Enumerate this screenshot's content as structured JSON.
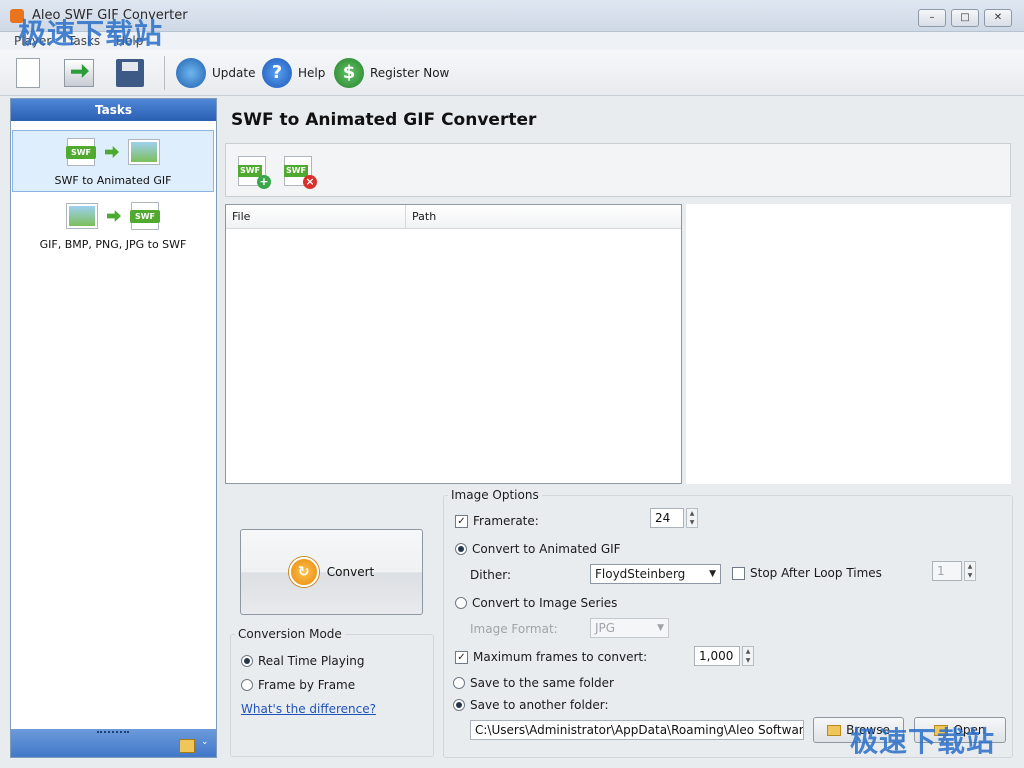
{
  "window": {
    "title": "Aleo SWF GIF Converter",
    "minimize": "–",
    "maximize": "□",
    "close": "✕"
  },
  "menu": [
    "Player",
    "Tasks",
    "Help"
  ],
  "toolbar": {
    "update_label": "Update",
    "help_label": "Help",
    "register_label": "Register Now",
    "help_glyph": "?",
    "register_glyph": "$"
  },
  "tasks": {
    "header": "Tasks",
    "items": [
      {
        "label": "SWF to Animated GIF",
        "selected": true
      },
      {
        "label": "GIF, BMP, PNG, JPG to SWF",
        "selected": false
      }
    ],
    "swf_tag": "SWF",
    "foot_chevron": "⌄"
  },
  "main": {
    "title": "SWF to Animated GIF Converter",
    "file_table": {
      "columns": [
        "File",
        "Path"
      ],
      "rows": []
    }
  },
  "convert": {
    "label": "Convert",
    "glyph": "↻"
  },
  "conversion_mode": {
    "legend": "Conversion Mode",
    "options": [
      {
        "label": "Real Time Playing",
        "selected": true
      },
      {
        "label": "Frame by Frame",
        "selected": false
      }
    ],
    "link": "What's the difference?"
  },
  "image_options": {
    "legend": "Image Options",
    "framerate_label": "Framerate:",
    "framerate_checked": true,
    "framerate_value": "24",
    "animated_gif_label": "Convert to Animated GIF",
    "dither_label": "Dither:",
    "dither_value": "FloydSteinberg",
    "stop_loop_label": "Stop After Loop Times",
    "loop_value": "1",
    "image_series_label": "Convert to Image Series",
    "image_format_label": "Image Format:",
    "image_format_value": "JPG",
    "max_frames_label": "Maximum frames to convert:",
    "max_frames_value": "1,000",
    "same_folder_label": "Save to the same folder",
    "another_folder_label": "Save to another folder:",
    "folder_path": "C:\\Users\\Administrator\\AppData\\Roaming\\Aleo Software\\",
    "browse_label": "Browse",
    "open_label": "Open"
  },
  "watermark": {
    "text": "极速下载站"
  },
  "check_glyph": "✓",
  "spin_up": "▲",
  "spin_down": "▼",
  "dropdown_glyph": "▼"
}
